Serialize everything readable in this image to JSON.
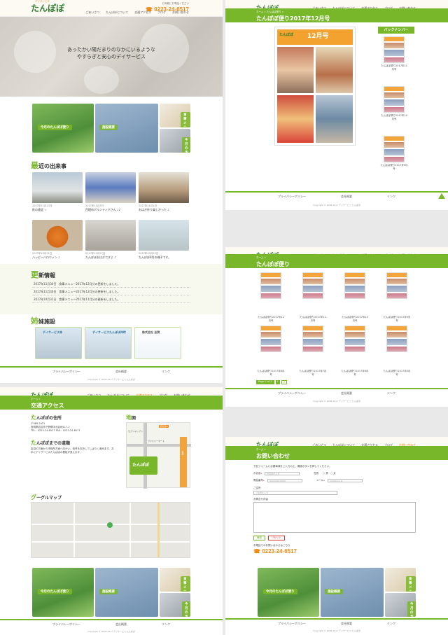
{
  "colors": {
    "accent": "#79b72a",
    "orange": "#ef8a12",
    "brand_green": "#2f7d2f"
  },
  "site": {
    "logo": "たんぽぽ",
    "logo_sub": "デイサービス",
    "tel_caption": "お気軽にお電話ください",
    "tel": "0223-24-6517",
    "nav": [
      "ごあいさつ",
      "たんぽぽについて",
      "交通アクセス",
      "ブログ",
      "お問い合わせ"
    ]
  },
  "home": {
    "hero_message_1": "あったかい陽だまりのなかにいるような",
    "hero_message_2": "やすらぎと安心のデイサービス",
    "tiles": {
      "newsletter": "今月のたんぽぽ便り",
      "menu": "食事メニュー",
      "facility": "施設概要",
      "schedule": "今月の予定"
    },
    "recent": {
      "title_initial": "最",
      "title_rest": "近の出来事",
      "items": [
        {
          "date": "2017年11月13日",
          "title": "秋の遠足 ☆"
        },
        {
          "date": "2017年11月7日",
          "title": "百理市ボランティアさん ♪♪"
        },
        {
          "date": "2017年11月1日",
          "title": "おはぎ作り楽しかった ♪"
        },
        {
          "date": "2017年10月31日",
          "title": "ハッピーハロウィン ♪"
        },
        {
          "date": "2017年10月27日",
          "title": "たんぽぽおはぎですよ ♪"
        },
        {
          "date": "2017年10月23日",
          "title": "たんぽぽ9月の様子です。"
        }
      ]
    },
    "updates": {
      "title_initial": "更",
      "title_rest": "新情報",
      "rows": [
        "2017年11月30日　食事メニュー2017年12月分の更新をしました。",
        "2017年11月30日　食事メニュー2017年12月分の更新をしました。",
        "2017年10月31日　食事メニュー2017年11月分の更新をしました。"
      ]
    },
    "sister": {
      "title_initial": "姉",
      "title_rest": "妹施設",
      "boxes": [
        "デイサービス林",
        "デイサービスたんぽぽ仲町",
        "株式会社 志賀"
      ]
    }
  },
  "footer": {
    "links": [
      "プライバシーポリシー",
      "会社概要",
      "リンク"
    ],
    "copyright": "Copyright © 2006-2017 デイサービス たんぽぽ"
  },
  "newsletter_page": {
    "breadcrumb": "ホーム » たんぽぽ便り »",
    "title": "たんぽぽ便り2017年12月号",
    "mag_title": "たんぽぽ",
    "mag_issue": "12月号",
    "backnumber": "バックナンバー",
    "backs": [
      "たんぽぽ便り2017年11月号",
      "たんぽぽ便り2017年10月号",
      "たんぽぽ便り2017年9月号"
    ]
  },
  "archive_page": {
    "breadcrumb": "ホーム »",
    "title": "たんぽぽ便り",
    "items": [
      "たんぽぽ便り2017年12月号",
      "たんぽぽ便り2017年11月号",
      "たんぽぽ便り2017年10月号",
      "たんぽぽ便り2017年9月号",
      "たんぽぽ便り2017年8月号",
      "たんぽぽ便り2017年7月号",
      "たんぽぽ便り2017年6月号",
      "たんぽぽ便り2017年5月号"
    ],
    "pager": [
      "Page 1 of 2",
      "1",
      "2"
    ]
  },
  "access_page": {
    "breadcrumb": "ホーム »",
    "title": "交通アクセス",
    "addr_title_initial": "た",
    "addr_title_rest": "んぽぽの住所",
    "addr_lines": [
      "〒989-2421",
      "宮城県岩沼市下野郷字北谷地117-2",
      "TEL：0223-24-6517 FAX：0223-24-6577"
    ],
    "route_title_initial": "た",
    "route_title_rest": "んぽぽまでの道順",
    "route_text": "岩沼IC方面から市役所方面へ向かい、信号を右折してしばらく進みます。左手にデイサービスたんぽぽの看板が見えます。",
    "map_title_initial": "地",
    "map_title_rest": "図",
    "map_labels": [
      "至岩沼IC",
      "セブンイレブン",
      "ファミリーマート",
      "県道"
    ],
    "google_title_initial": "グ",
    "google_title_rest": "ーグルマップ"
  },
  "contact_page": {
    "breadcrumb": "ホーム »",
    "title": "お問い合わせ",
    "intro": "下記フォームに必要事項をご入力の上、確認ボタンを押してください。",
    "fields": {
      "name": "お名前",
      "name_ph": "お名前を入力",
      "gender": "性別",
      "male": "男",
      "female": "女",
      "phone": "電話番号",
      "phone_ph": "000-0000-0000",
      "email": "メール",
      "email_ph": "mail@xxx.jp",
      "address": "ご住所",
      "address_ph": "ご住所を入力",
      "message": "お問合せ内容"
    },
    "confirm": "確認",
    "reset": "リセット",
    "note": "お電話でのお問い合わせはこちら",
    "tel": "0223-24-6517"
  }
}
